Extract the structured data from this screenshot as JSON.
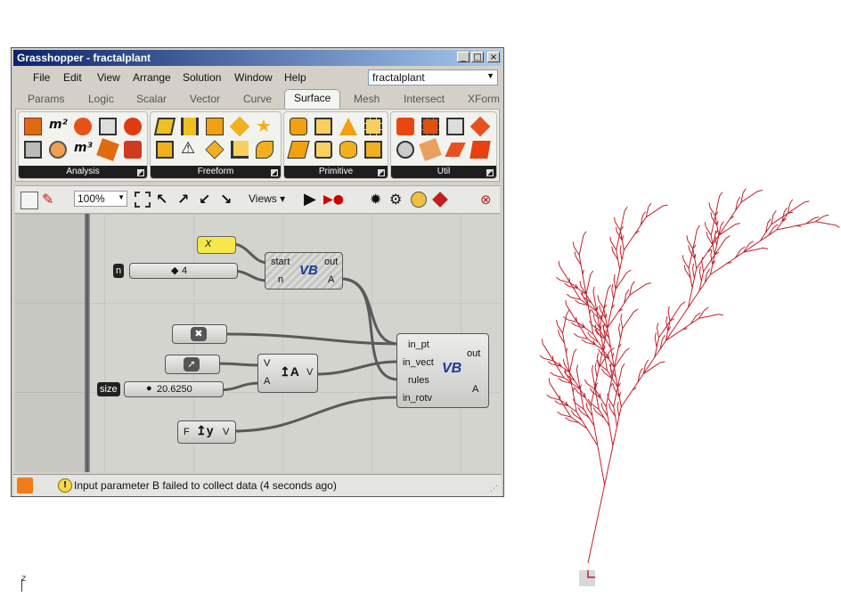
{
  "window": {
    "title": "Grasshopper - fractalplant",
    "controls": [
      "_",
      "□",
      "×"
    ]
  },
  "menu": {
    "items": [
      "File",
      "Edit",
      "View",
      "Arrange",
      "Solution",
      "Window",
      "Help"
    ],
    "document": "fractalplant"
  },
  "tabs": [
    "Params",
    "Logic",
    "Scalar",
    "Vector",
    "Curve",
    "Surface",
    "Mesh",
    "Intersect",
    "XForm"
  ],
  "active_tab": "Surface",
  "ribbon": {
    "panels": [
      "Analysis",
      "Freeform",
      "Primitive",
      "Util"
    ]
  },
  "toolbar": {
    "zoom": "100%",
    "views_label": "Views"
  },
  "canvas": {
    "string_param": "X",
    "n_tag": "n",
    "n_value": "4",
    "vb1_inputs": [
      "start",
      "n"
    ],
    "vb1_outputs": [
      "out",
      "A"
    ],
    "vb_logo": "VB",
    "size_tag": "size",
    "size_value": "20.6250",
    "vector_inputs": [
      "V",
      "A"
    ],
    "vector_output": "V",
    "vector_icon": "↥A",
    "func_input": "F",
    "func_icon": "↥y",
    "func_output": "V",
    "vb2_inputs": [
      "in_pt",
      "in_vect",
      "rules",
      "in_rotv"
    ],
    "vb2_outputs": [
      "out",
      "A"
    ]
  },
  "status": {
    "message": "Input parameter B failed to collect data (4 seconds ago)"
  },
  "viewport": {
    "axis_label": "z"
  },
  "colors": {
    "tree_line": "#c0202a",
    "title_bar": "#0a246a",
    "ribbon_label_bg": "#1e1e1e"
  }
}
